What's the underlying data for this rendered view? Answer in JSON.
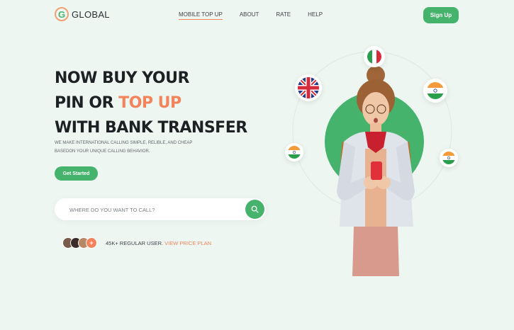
{
  "brand": {
    "letter": "G",
    "name": "GLOBAL"
  },
  "nav": {
    "items": [
      {
        "label": "MOBILE TOP UP",
        "active": true
      },
      {
        "label": "ABOUT",
        "active": false
      },
      {
        "label": "RATE",
        "active": false
      },
      {
        "label": "HELP",
        "active": false
      }
    ],
    "signup_label": "Sign Up"
  },
  "hero": {
    "headline_line1": "NOW BUY YOUR",
    "headline_line2_prefix": "PIN OR ",
    "headline_line2_accent": "TOP UP",
    "headline_line3": "WITH BANK TRANSFER",
    "subtext_line1": "WE MAKE INTERNATIONAL CALLING SIMPLE, RELIBLE, AND CHEAP",
    "subtext_line2": "BASEDON YOUR UNIQUE CALLING BEHAVIOR.",
    "cta_label": "Get Started"
  },
  "search": {
    "placeholder": "WHERE DO YOU WANT TO CALL?",
    "icon": "search-icon"
  },
  "users": {
    "count_text": "45K+ REGULAR USER.",
    "link_text": "VIEW PRICE PLAN",
    "more_glyph": "+"
  },
  "flags": [
    "italy-flag-icon",
    "uk-flag-icon",
    "india-flag-icon",
    "india-flag-icon",
    "india-flag-icon"
  ],
  "colors": {
    "primary": "#46b36c",
    "accent": "#f2835a",
    "background": "#eef6f2",
    "text": "#1d2124"
  }
}
